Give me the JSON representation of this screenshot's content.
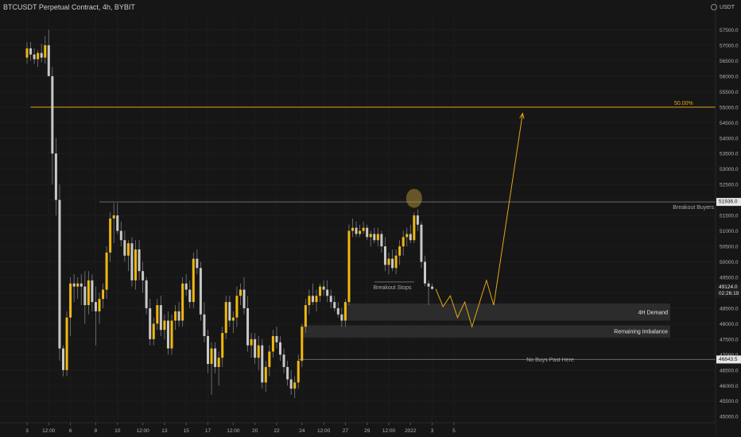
{
  "header": {
    "title": "BTCUSDT Perpetual Contract, 4h, BYBIT",
    "currency": "USDT"
  },
  "colors": {
    "background": "#161616",
    "up": "#f0b80e",
    "down": "#c8c8c8",
    "wick": "#7d7d7d",
    "line": "#6a6a6a",
    "target": "#e3a913",
    "zone": "#2c2c2c",
    "text": "#a9a9a9"
  },
  "chart_data": {
    "type": "candlestick",
    "title": "BTCUSDT Perpetual Contract, 4h, BYBIT",
    "ylim": [
      44800,
      58000
    ],
    "yticks": [
      45000,
      45500,
      46000,
      46500,
      47000,
      47500,
      48000,
      48500,
      49000,
      49500,
      50000,
      50500,
      51000,
      51500,
      52000,
      52500,
      53000,
      53500,
      54000,
      54500,
      55000,
      55500,
      56000,
      56500,
      57000,
      57500
    ],
    "xticks": [
      "3",
      "12:00",
      "6",
      "8",
      "10",
      "12:00",
      "13",
      "15",
      "17",
      "12:00",
      "20",
      "22",
      "24",
      "12:00",
      "27",
      "29",
      "12:00",
      "2022",
      "3",
      "5"
    ],
    "xtick_index": [
      0,
      6,
      12,
      19,
      25,
      32,
      38,
      44,
      50,
      57,
      63,
      69,
      76,
      82,
      88,
      94,
      100,
      106,
      112,
      118
    ],
    "candles": [
      [
        56600,
        57100,
        56400,
        56900
      ],
      [
        56900,
        57100,
        56500,
        56700
      ],
      [
        56700,
        56900,
        56400,
        56550
      ],
      [
        56550,
        56850,
        56300,
        56750
      ],
      [
        56750,
        57050,
        56450,
        56600
      ],
      [
        56600,
        57300,
        56400,
        57000
      ],
      [
        57000,
        57500,
        56500,
        56000
      ],
      [
        56000,
        56300,
        52500,
        53500
      ],
      [
        53500,
        54000,
        51500,
        52000
      ],
      [
        52000,
        52500,
        46800,
        47200
      ],
      [
        47200,
        47300,
        46300,
        46500
      ],
      [
        46500,
        48400,
        46300,
        48200
      ],
      [
        48200,
        49500,
        47600,
        49300
      ],
      [
        49300,
        49600,
        48700,
        49200
      ],
      [
        49200,
        49500,
        48800,
        49300
      ],
      [
        49300,
        49600,
        48600,
        49200
      ],
      [
        49200,
        49700,
        48000,
        48600
      ],
      [
        48600,
        49700,
        48300,
        49400
      ],
      [
        49400,
        49600,
        48400,
        48700
      ],
      [
        48700,
        49200,
        47300,
        48400
      ],
      [
        48400,
        49000,
        48000,
        48800
      ],
      [
        48800,
        49300,
        48500,
        49100
      ],
      [
        49100,
        50500,
        48800,
        50300
      ],
      [
        50300,
        51600,
        50000,
        51400
      ],
      [
        51400,
        51900,
        50600,
        51500
      ],
      [
        51500,
        51900,
        50900,
        51000
      ],
      [
        51000,
        51300,
        50500,
        50700
      ],
      [
        50700,
        51000,
        50000,
        50200
      ],
      [
        50200,
        50700,
        49700,
        50600
      ],
      [
        50600,
        50800,
        49200,
        49400
      ],
      [
        49400,
        50700,
        49100,
        50400
      ],
      [
        50400,
        50700,
        49400,
        49700
      ],
      [
        49700,
        50000,
        49000,
        49400
      ],
      [
        49400,
        49500,
        48300,
        48500
      ],
      [
        48500,
        48800,
        47300,
        47500
      ],
      [
        47500,
        48200,
        47300,
        48000
      ],
      [
        48000,
        48800,
        47800,
        48600
      ],
      [
        48600,
        48900,
        47600,
        47800
      ],
      [
        47800,
        48300,
        47500,
        48100
      ],
      [
        48100,
        48400,
        47000,
        47200
      ],
      [
        47200,
        48300,
        47000,
        48100
      ],
      [
        48100,
        48600,
        47800,
        48400
      ],
      [
        48400,
        48700,
        47900,
        48100
      ],
      [
        48100,
        49500,
        47900,
        49300
      ],
      [
        49300,
        49600,
        48900,
        49100
      ],
      [
        49100,
        49400,
        48500,
        48700
      ],
      [
        48700,
        50300,
        48500,
        50100
      ],
      [
        50100,
        50400,
        49600,
        49800
      ],
      [
        49800,
        50000,
        48100,
        48300
      ],
      [
        48300,
        48700,
        47400,
        47600
      ],
      [
        47600,
        47800,
        46400,
        46700
      ],
      [
        46700,
        47400,
        45700,
        47200
      ],
      [
        47200,
        47400,
        46400,
        46600
      ],
      [
        46600,
        47100,
        46000,
        46900
      ],
      [
        46900,
        47900,
        46600,
        47700
      ],
      [
        47700,
        48900,
        47500,
        48700
      ],
      [
        48700,
        48900,
        47900,
        48100
      ],
      [
        48100,
        48400,
        47700,
        48200
      ],
      [
        48200,
        49200,
        47900,
        48900
      ],
      [
        48900,
        49300,
        48600,
        49100
      ],
      [
        49100,
        49500,
        48300,
        48500
      ],
      [
        48500,
        48900,
        47100,
        47300
      ],
      [
        47300,
        47700,
        46900,
        47500
      ],
      [
        47500,
        47700,
        46700,
        46900
      ],
      [
        46900,
        47600,
        46500,
        47300
      ],
      [
        47300,
        47500,
        45900,
        46100
      ],
      [
        46100,
        46800,
        45800,
        46600
      ],
      [
        46600,
        47300,
        46300,
        47100
      ],
      [
        47100,
        47800,
        46900,
        47600
      ],
      [
        47600,
        47900,
        47200,
        47400
      ],
      [
        47400,
        47600,
        46800,
        47000
      ],
      [
        47000,
        47200,
        46400,
        46600
      ],
      [
        46600,
        46800,
        46000,
        46200
      ],
      [
        46200,
        46500,
        45700,
        45900
      ],
      [
        45900,
        46300,
        45600,
        46100
      ],
      [
        46100,
        47000,
        45900,
        46800
      ],
      [
        46800,
        48000,
        46600,
        47900
      ],
      [
        47900,
        48800,
        47700,
        48600
      ],
      [
        48600,
        49100,
        48300,
        48900
      ],
      [
        48900,
        49300,
        48600,
        48700
      ],
      [
        48700,
        49100,
        48400,
        48900
      ],
      [
        48900,
        49300,
        48700,
        49200
      ],
      [
        49200,
        49400,
        48900,
        49100
      ],
      [
        49100,
        49400,
        48700,
        48900
      ],
      [
        48900,
        49100,
        48500,
        48700
      ],
      [
        48700,
        48900,
        48400,
        48500
      ],
      [
        48500,
        48700,
        48200,
        48300
      ],
      [
        48300,
        48500,
        47900,
        48100
      ],
      [
        48100,
        48800,
        47900,
        48700
      ],
      [
        48700,
        51200,
        48600,
        51000
      ],
      [
        51000,
        51400,
        50800,
        51100
      ],
      [
        51100,
        51300,
        50800,
        50900
      ],
      [
        50900,
        51200,
        50800,
        51000
      ],
      [
        51000,
        51300,
        50900,
        51100
      ],
      [
        51100,
        51200,
        50700,
        50800
      ],
      [
        50800,
        51000,
        50500,
        50900
      ],
      [
        50900,
        51100,
        50600,
        50700
      ],
      [
        50700,
        51100,
        50500,
        50900
      ],
      [
        50900,
        51000,
        50300,
        50500
      ],
      [
        50500,
        50800,
        49700,
        49900
      ],
      [
        49900,
        50300,
        49600,
        50100
      ],
      [
        50100,
        50400,
        49700,
        49800
      ],
      [
        49800,
        50400,
        49600,
        50200
      ],
      [
        50200,
        50700,
        49900,
        50500
      ],
      [
        50500,
        51000,
        50200,
        50800
      ],
      [
        50800,
        51100,
        50500,
        50900
      ],
      [
        50900,
        51200,
        50600,
        50700
      ],
      [
        50700,
        51600,
        50600,
        51500
      ],
      [
        51500,
        51700,
        51000,
        51200
      ],
      [
        51200,
        51300,
        49800,
        50000
      ],
      [
        50000,
        50200,
        49200,
        49300
      ],
      [
        49300,
        49400,
        48600,
        49200
      ],
      [
        49200,
        49300,
        49100,
        49124
      ]
    ],
    "levels": [
      {
        "price": 55000,
        "label": "50.00%"
      },
      {
        "price": 51936,
        "label": "Breakout Buyers",
        "axis_label": "51936.0"
      },
      {
        "price": 46843.5,
        "label": "No Buys Past Here",
        "axis_label": "46843.5"
      },
      {
        "price": 49350,
        "label": "Breakout Stops"
      }
    ],
    "zones": [
      {
        "label": "4H Demand",
        "top": 48650,
        "bottom": 48100
      },
      {
        "label": "Remaining Imbalance",
        "top": 47950,
        "bottom": 47550
      }
    ],
    "last_price": {
      "value": "49124.0",
      "countdown": "02:26:19"
    },
    "projection": [
      [
        113,
        49124
      ],
      [
        115,
        48550
      ],
      [
        117,
        48900
      ],
      [
        119,
        48200
      ],
      [
        121,
        48700
      ],
      [
        123,
        47900
      ],
      [
        127,
        49400
      ],
      [
        129,
        48600
      ],
      [
        137,
        54800
      ]
    ],
    "highlight": {
      "index": 107,
      "price": 51950
    }
  }
}
